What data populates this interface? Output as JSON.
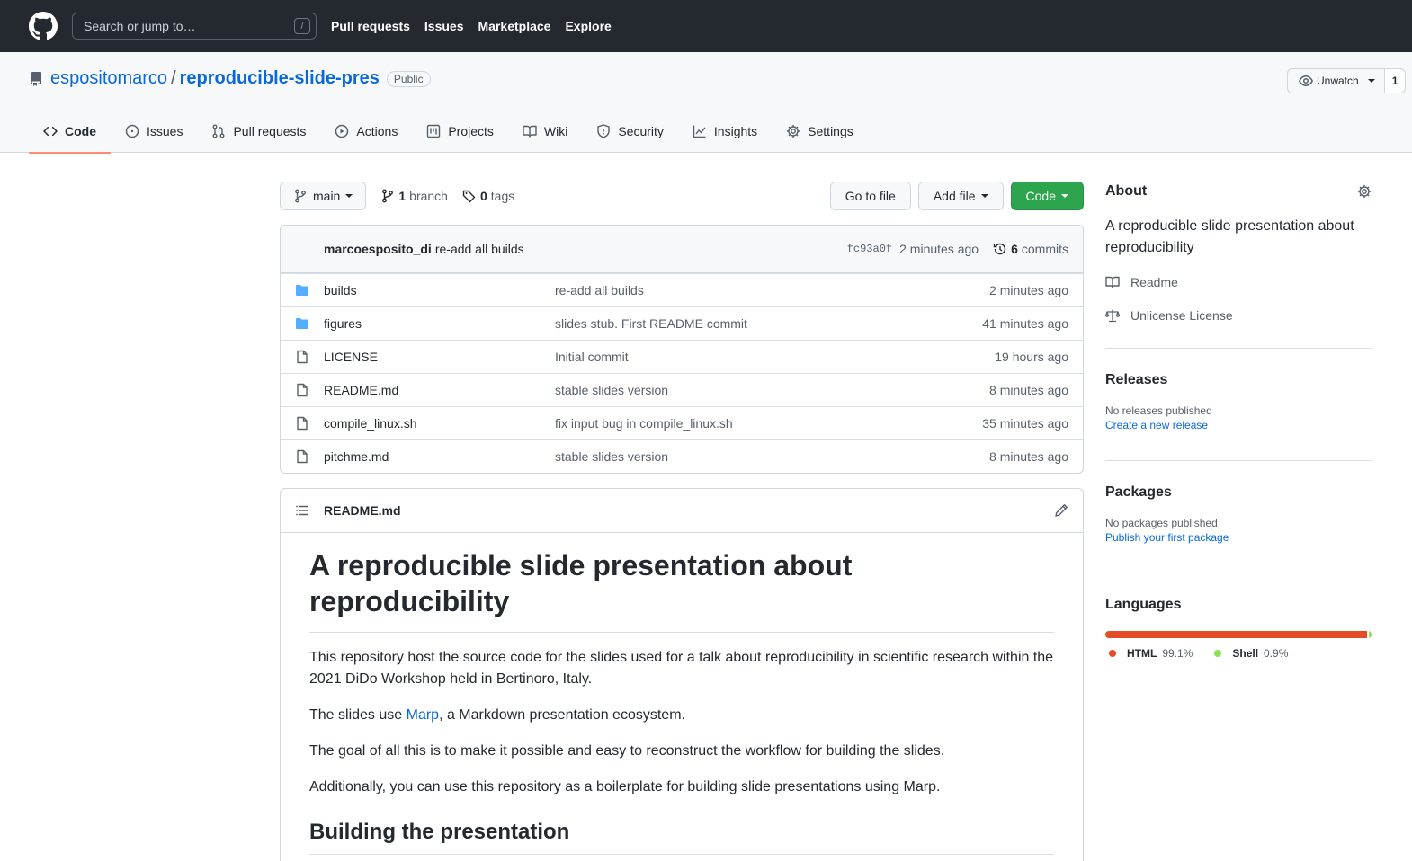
{
  "header": {
    "search_placeholder": "Search or jump to…",
    "search_shortcut": "/",
    "nav": [
      "Pull requests",
      "Issues",
      "Marketplace",
      "Explore"
    ]
  },
  "repo": {
    "owner": "espositomarco",
    "separator": "/",
    "name": "reproducible-slide-pres",
    "visibility": "Public",
    "watch_label": "Unwatch",
    "watch_count": "1",
    "tabs": [
      {
        "label": "Code",
        "icon": "code-icon",
        "selected": true
      },
      {
        "label": "Issues",
        "icon": "issue-icon"
      },
      {
        "label": "Pull requests",
        "icon": "pull-request-icon"
      },
      {
        "label": "Actions",
        "icon": "play-icon"
      },
      {
        "label": "Projects",
        "icon": "project-icon"
      },
      {
        "label": "Wiki",
        "icon": "book-icon"
      },
      {
        "label": "Security",
        "icon": "shield-icon"
      },
      {
        "label": "Insights",
        "icon": "graph-icon"
      },
      {
        "label": "Settings",
        "icon": "gear-icon"
      }
    ]
  },
  "toolbar": {
    "branch": "main",
    "branch_count": "1",
    "branch_label": "branch",
    "tag_count": "0",
    "tag_label": "tags",
    "go_to_file": "Go to file",
    "add_file": "Add file",
    "code": "Code"
  },
  "latest_commit": {
    "author": "marcoesposito_di",
    "message": "re-add all builds",
    "sha": "fc93a0f",
    "age": "2 minutes ago",
    "commit_count": "6",
    "commit_label": "commits"
  },
  "files": [
    {
      "name": "builds",
      "type": "folder",
      "message": "re-add all builds",
      "age": "2 minutes ago"
    },
    {
      "name": "figures",
      "type": "folder",
      "message": "slides stub. First README commit",
      "age": "41 minutes ago"
    },
    {
      "name": "LICENSE",
      "type": "file",
      "message": "Initial commit",
      "age": "19 hours ago"
    },
    {
      "name": "README.md",
      "type": "file",
      "message": "stable slides version",
      "age": "8 minutes ago"
    },
    {
      "name": "compile_linux.sh",
      "type": "file",
      "message": "fix input bug in compile_linux.sh",
      "age": "35 minutes ago"
    },
    {
      "name": "pitchme.md",
      "type": "file",
      "message": "stable slides version",
      "age": "8 minutes ago"
    }
  ],
  "readme": {
    "filename": "README.md",
    "h1": "A reproducible slide presentation about reproducibility",
    "p1": "This repository host the source code for the slides used for a talk about reproducibility in scientific research within the 2021 DiDo Workshop held in Bertinoro, Italy.",
    "p2_pre": "The slides use ",
    "p2_link": "Marp",
    "p2_post": ", a Markdown presentation ecosystem.",
    "p3": "The goal of all this is to make it possible and easy to reconstruct the workflow for building the slides.",
    "p4": "Additionally, you can use this repository as a boilerplate for building slide presentations using Marp.",
    "h2": "Building the presentation"
  },
  "sidebar": {
    "about_title": "About",
    "description": "A reproducible slide presentation about reproducibility",
    "readme_label": "Readme",
    "license_label": "Unlicense License",
    "releases_title": "Releases",
    "releases_empty": "No releases published",
    "releases_link": "Create a new release",
    "packages_title": "Packages",
    "packages_empty": "No packages published",
    "packages_link": "Publish your first package",
    "languages_title": "Languages",
    "languages": [
      {
        "name": "HTML",
        "percent": "99.1%",
        "fraction": 0.991,
        "color": "#e34c26"
      },
      {
        "name": "Shell",
        "percent": "0.9%",
        "fraction": 0.009,
        "color": "#89e051"
      }
    ]
  }
}
